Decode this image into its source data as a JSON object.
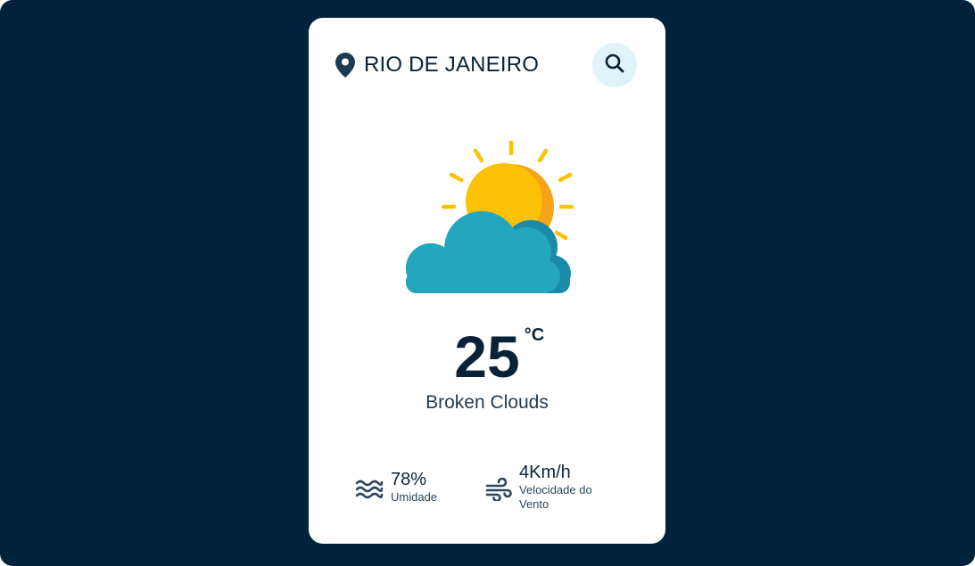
{
  "location": {
    "city": "RIO DE JANEIRO",
    "icon": "map-pin-icon"
  },
  "search": {
    "icon": "search-icon"
  },
  "weather": {
    "icon": "partly-cloudy-icon",
    "temperature": "25",
    "unit": "°C",
    "description": "Broken Clouds"
  },
  "humidity": {
    "icon": "waves-icon",
    "value": "78%",
    "label": "Umidade"
  },
  "wind": {
    "icon": "wind-icon",
    "value": "4Km/h",
    "label": "Velocidade do Vento"
  },
  "colors": {
    "background": "#00233b",
    "card": "#ffffff",
    "text_dark": "#0a2238",
    "search_bg": "#dff3fb",
    "sun": "#fcc105",
    "sun_shade": "#f7a31a",
    "cloud": "#24a6bd",
    "cloud_shade": "#1a8aa8"
  }
}
